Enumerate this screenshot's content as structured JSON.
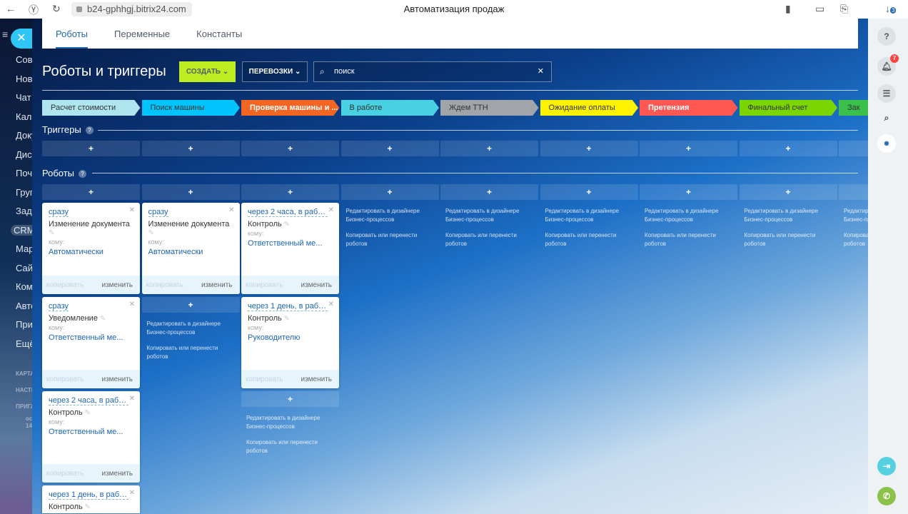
{
  "browser": {
    "url": "b24-gphhgj.bitrix24.com",
    "title": "Автоматизация продаж",
    "downloads_count": "3"
  },
  "leftnav": [
    "Совм",
    "Нові",
    "Чат",
    "Кале",
    "Доку",
    "Диск",
    "Почт",
    "Груп",
    "Зада",
    "CRM",
    "Мар",
    "Сайт",
    "Ком",
    "Авто",
    "При",
    "Ещё"
  ],
  "leftnav_small": [
    "КАРТА",
    "НАСТР",
    "ПРИГЛ"
  ],
  "leftnav_user": {
    "line1": "ос",
    "line2": "14"
  },
  "tabs": [
    "Роботы",
    "Переменные",
    "Константы"
  ],
  "header": {
    "title": "Роботы и триггеры",
    "create": "СОЗДАТЬ",
    "category": "ПЕРЕВОЗКИ",
    "search": "поиск"
  },
  "stages": [
    {
      "name": "Расчет стоимости",
      "bg": "#aee5ee",
      "fg": "#333"
    },
    {
      "name": "Поиск машины",
      "bg": "#00c4fb",
      "fg": "#333"
    },
    {
      "name": "Проверка машины и ...",
      "bg": "#f26522",
      "fg": "#fff"
    },
    {
      "name": "В работе",
      "bg": "#47d1e2",
      "fg": "#333"
    },
    {
      "name": "Ждем ТТН",
      "bg": "#a1a5a9",
      "fg": "#333"
    },
    {
      "name": "Ожидание оплаты",
      "bg": "#fff200",
      "fg": "#333"
    },
    {
      "name": "Претензия",
      "bg": "#ff5752",
      "fg": "#fff"
    },
    {
      "name": "Финальный счет",
      "bg": "#7bd500",
      "fg": "#333"
    },
    {
      "name": "Зак",
      "bg": "#3bc04c",
      "fg": "#333"
    }
  ],
  "sections": {
    "triggers": "Триггеры",
    "robots": "Роботы"
  },
  "labels": {
    "to": "кому:",
    "copy": "копировать",
    "edit": "изменить",
    "plus": "+",
    "designer": "Редактировать в дизайнере Бизнес-процессов",
    "move": "Копировать или перенести роботов"
  },
  "columns": [
    [
      {
        "delay": "сразу",
        "name": "Изменение документа",
        "to": "Автоматически"
      },
      {
        "delay": "сразу",
        "name": "Уведомление",
        "to": "Ответственный ме..."
      },
      {
        "delay": "через 2 часа, в рабо...",
        "name": "Контроль",
        "to": "Ответственный ме..."
      },
      {
        "delay": "через 1 день, в рабо...",
        "name": "Контроль",
        "to": ""
      }
    ],
    [
      {
        "delay": "сразу",
        "name": "Изменение документа",
        "to": "Автоматически"
      }
    ],
    [
      {
        "delay": "через 2 часа, в рабо...",
        "name": "Контроль",
        "to": "Ответственный ме..."
      },
      {
        "delay": "через 1 день, в рабо...",
        "name": "Контроль",
        "to": "Руководителю"
      }
    ],
    [],
    [],
    [],
    [],
    [],
    []
  ],
  "right": {
    "notifications": "7"
  }
}
